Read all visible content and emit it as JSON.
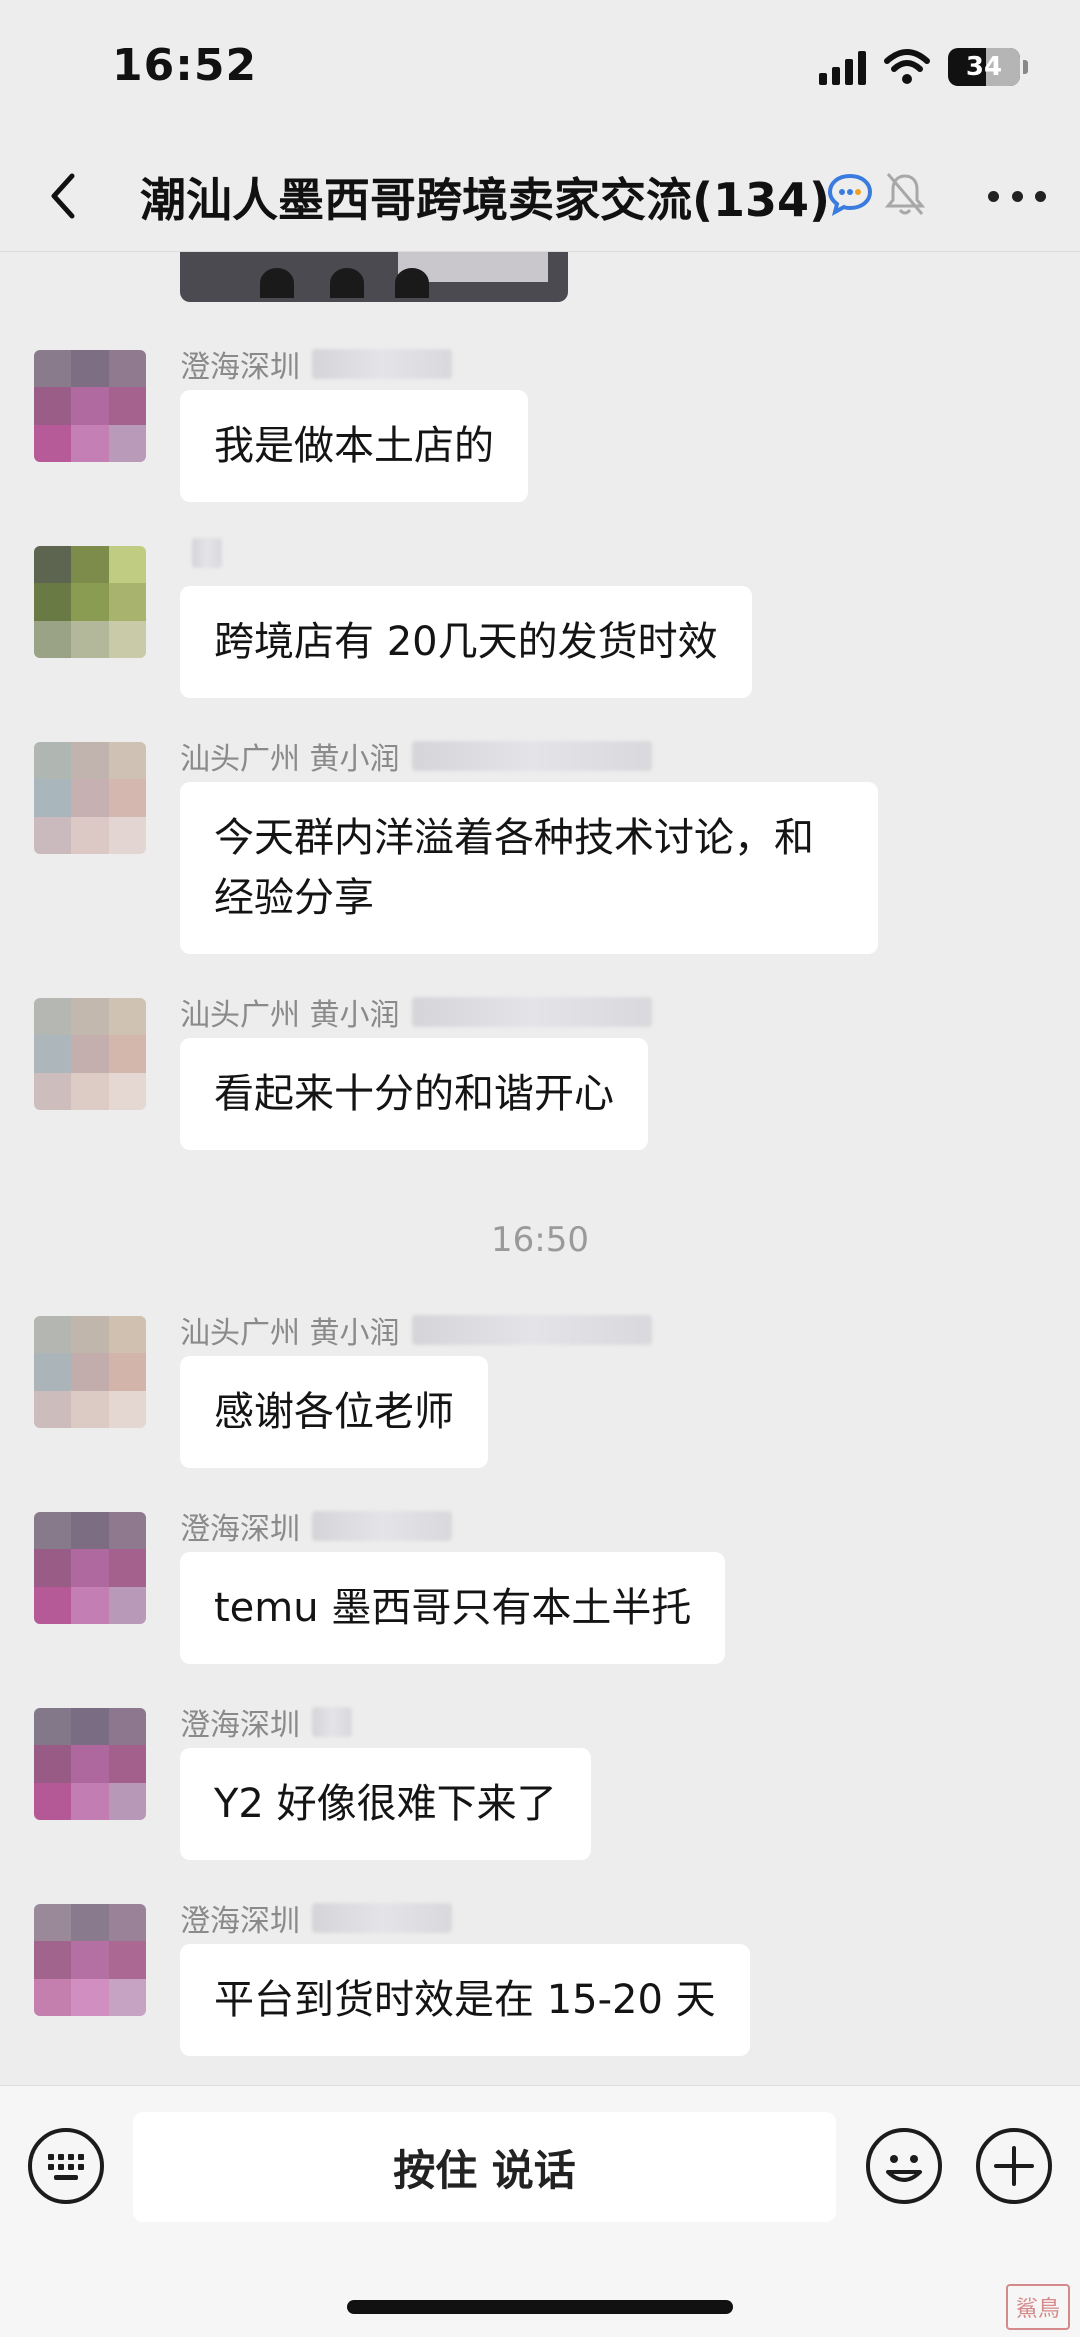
{
  "status_bar": {
    "time": "16:52",
    "battery": "34"
  },
  "header": {
    "title": "潮汕人墨西哥跨境卖家交流(134)"
  },
  "messages": [
    {
      "sender": "澄海深圳",
      "text": "我是做本土店的"
    },
    {
      "sender": "",
      "text": "跨境店有 20几天的发货时效"
    },
    {
      "sender": "汕头广州 黄小润",
      "text": "今天群内洋溢着各种技术讨论，和经验分享"
    },
    {
      "sender": "汕头广州 黄小润",
      "text": "看起来十分的和谐开心"
    },
    {
      "sender": "汕头广州 黄小润",
      "text": "感谢各位老师"
    },
    {
      "sender": "澄海深圳",
      "text": "temu 墨西哥只有本土半托"
    },
    {
      "sender": "澄海深圳",
      "text": "Y2 好像很难下来了"
    },
    {
      "sender": "澄海深圳",
      "text": "平台到货时效是在 15-20 天"
    }
  ],
  "timestamp": "16:50",
  "input_bar": {
    "hold_to_talk": "按住 说话"
  },
  "watermark": "鯊鳥",
  "icons": {
    "back": "chevron-left-icon",
    "group_chat": "chat-bubble-icon",
    "mute": "bell-off-icon",
    "more": "more-dots-icon",
    "keyboard": "keyboard-icon",
    "emoji": "emoji-icon",
    "add": "plus-circle-icon"
  }
}
